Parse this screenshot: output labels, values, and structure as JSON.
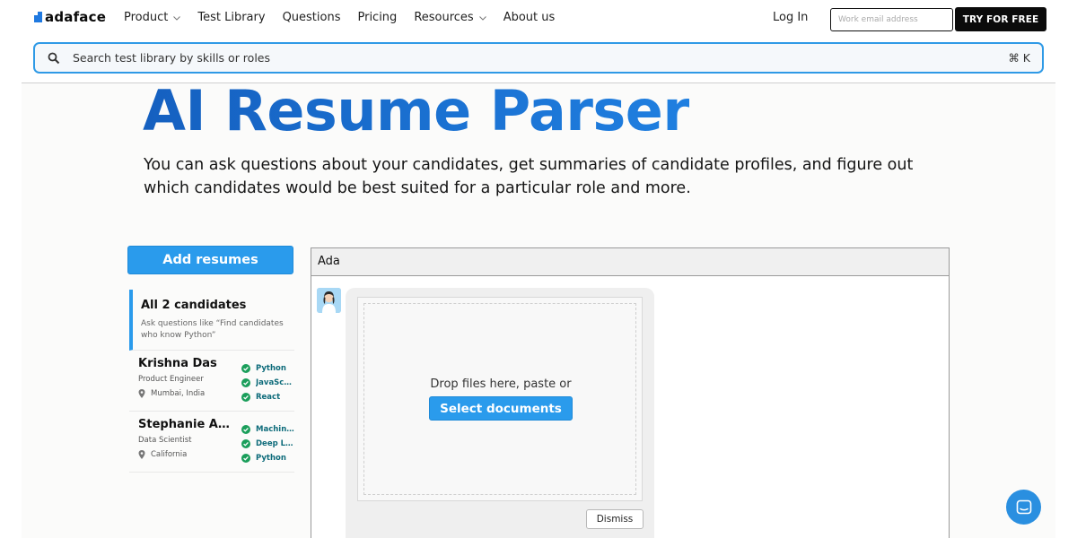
{
  "brand": {
    "name": "adaface",
    "accent": "#2a9bec"
  },
  "nav": {
    "items": [
      {
        "label": "Product",
        "has_dropdown": true
      },
      {
        "label": "Test Library",
        "has_dropdown": false
      },
      {
        "label": "Questions",
        "has_dropdown": false
      },
      {
        "label": "Pricing",
        "has_dropdown": false
      },
      {
        "label": "Resources",
        "has_dropdown": true
      },
      {
        "label": "About us",
        "has_dropdown": false
      }
    ],
    "login": "Log In",
    "email_placeholder": "Work email address",
    "try_button": "TRY FOR FREE"
  },
  "search": {
    "placeholder": "Search test library by skills or roles",
    "shortcut": "⌘ K"
  },
  "hero": {
    "title": "AI Resume Parser",
    "subtitle": "You can ask questions about your candidates, get summaries of candidate profiles, and figure out which candidates would be best suited for a particular role and more."
  },
  "sidebar": {
    "add_button": "Add resumes",
    "all": {
      "title": "All 2 candidates",
      "hint": "Ask questions like “Find candidates who know Python”"
    },
    "candidates": [
      {
        "name": "Krishna Das",
        "role": "Product Engineer",
        "location": "Mumbai, India",
        "skills": [
          "Python",
          "JavaScript",
          "React"
        ]
      },
      {
        "name": "Stephanie Ar...",
        "role": "Data Scientist",
        "location": "California",
        "skills": [
          "Machine Learning",
          "Deep Learning",
          "Python"
        ]
      }
    ]
  },
  "chat": {
    "header": "Ada",
    "drop_text": "Drop files here, paste or",
    "select_button": "Select documents",
    "dismiss_button": "Dismiss"
  }
}
